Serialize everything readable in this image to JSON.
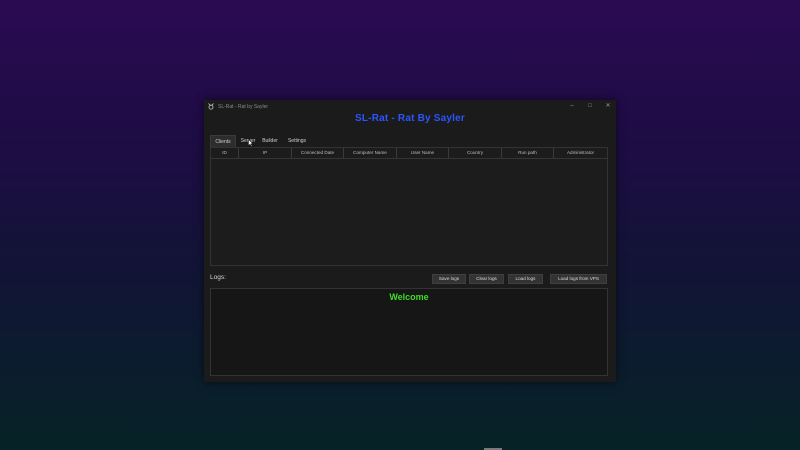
{
  "window": {
    "title": "SL-Rat - Rat by Sayler",
    "controls": {
      "minimize": "–",
      "maximize": "□",
      "close": "✕"
    }
  },
  "header": {
    "title": "SL-Rat - Rat By Sayler"
  },
  "tabs": [
    {
      "label": "Clients",
      "selected": true
    },
    {
      "label": "Server",
      "selected": false
    },
    {
      "label": "Builder",
      "selected": false
    },
    {
      "label": "Settings",
      "selected": false
    }
  ],
  "table": {
    "columns": [
      "ID",
      "IP",
      "Connected Date",
      "Computer Name",
      "User Name",
      "Country",
      "Run path",
      "Administrator"
    ],
    "rows": []
  },
  "logs": {
    "label": "Logs:",
    "buttons": {
      "save": "Save logs",
      "clear": "Clear logs",
      "load": "Load logs",
      "load_vps": "Load logs from VPS"
    },
    "content": "Welcome"
  },
  "colors": {
    "title_blue": "#2a55ff",
    "welcome_green": "#3ddc24",
    "window_bg": "#1b1b1b"
  }
}
